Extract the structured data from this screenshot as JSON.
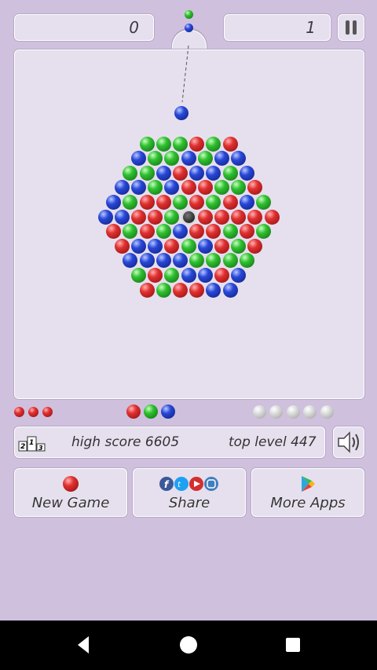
{
  "score": "0",
  "level": "1",
  "info": {
    "high_score": "high score 6605",
    "top_level": "top level 447"
  },
  "buttons": {
    "new_game": "New Game",
    "share": "Share",
    "more_apps": "More Apps"
  },
  "queue_next": [
    "green",
    "blue"
  ],
  "shooter_ball": "blue",
  "rows": [
    [
      "green",
      "green",
      "green",
      "red",
      "green",
      "red"
    ],
    [
      "blue",
      "green",
      "green",
      "blue",
      "green",
      "blue",
      "blue"
    ],
    [
      "green",
      "green",
      "blue",
      "red",
      "blue",
      "blue",
      "green",
      "blue"
    ],
    [
      "blue",
      "blue",
      "green",
      "blue",
      "red",
      "red",
      "green",
      "green",
      "red"
    ],
    [
      "blue",
      "green",
      "red",
      "red",
      "green",
      "red",
      "green",
      "red",
      "blue",
      "green"
    ],
    [
      "blue",
      "blue",
      "red",
      "red",
      "green",
      "center",
      "red",
      "red",
      "red",
      "red",
      "red"
    ],
    [
      "red",
      "green",
      "red",
      "green",
      "blue",
      "red",
      "red",
      "green",
      "red",
      "green"
    ],
    [
      "red",
      "blue",
      "blue",
      "red",
      "green",
      "blue",
      "red",
      "green",
      "red"
    ],
    [
      "blue",
      "blue",
      "blue",
      "blue",
      "green",
      "green",
      "green",
      "green"
    ],
    [
      "green",
      "red",
      "green",
      "blue",
      "blue",
      "red",
      "blue"
    ],
    [
      "red",
      "green",
      "red",
      "red",
      "blue",
      "blue"
    ]
  ],
  "shots_left_red": 3,
  "next_shots": [
    "red",
    "green",
    "blue"
  ],
  "grey_slots": 5,
  "colors": {
    "background": "#cfc0de",
    "panel": "#e6dfee",
    "navbar": "#000000"
  },
  "icons": [
    "pause-icon",
    "podium-icon",
    "speaker-icon",
    "ball-icon",
    "social-icons",
    "play-store-icon",
    "back-icon",
    "home-icon",
    "recents-icon"
  ]
}
